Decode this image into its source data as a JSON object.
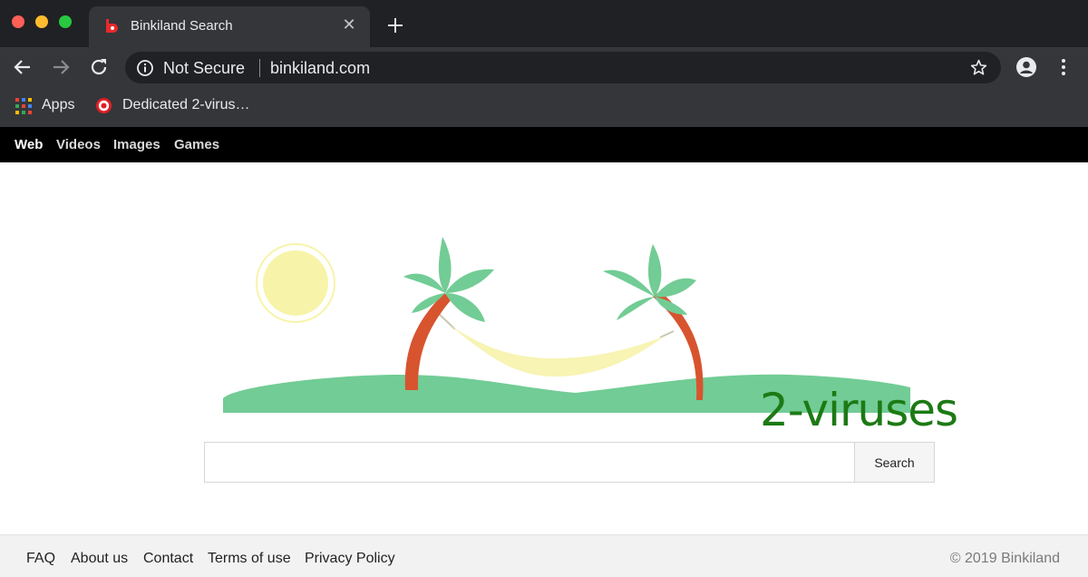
{
  "browser": {
    "tab": {
      "title": "Binkiland Search",
      "favicon": "binkiland-b-icon"
    },
    "address": {
      "security_label": "Not Secure",
      "url": "binkiland.com"
    },
    "bookmarks": [
      {
        "label": "Apps",
        "icon": "apps-grid-icon"
      },
      {
        "label": "Dedicated 2-virus…",
        "icon": "target-icon"
      }
    ]
  },
  "site_nav": {
    "items": [
      {
        "label": "Web",
        "active": true
      },
      {
        "label": "Videos",
        "active": false
      },
      {
        "label": "Images",
        "active": false
      },
      {
        "label": "Games",
        "active": false
      }
    ]
  },
  "hero": {
    "illustration": "beach-hammock-palm-trees",
    "watermark": "2-viruses",
    "colors": {
      "sun": "#f7f4a9",
      "grass": "#72cc95",
      "trunk": "#d7542f",
      "leaves": "#72cc95",
      "hammock": "#f7f4b4",
      "watermark": "#1c7a14"
    }
  },
  "search": {
    "value": "",
    "button_label": "Search"
  },
  "footer": {
    "links": [
      "FAQ",
      "About us",
      "Contact",
      "Terms of use",
      "Privacy Policy"
    ],
    "copyright": "© 2019 Binkiland"
  }
}
